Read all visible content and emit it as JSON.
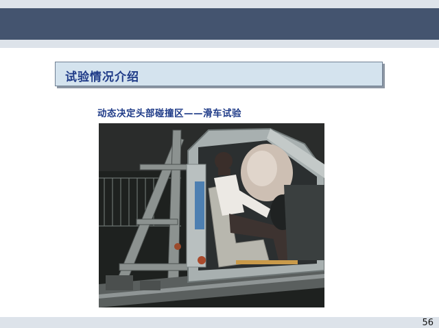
{
  "slide": {
    "section_title": "试验情况介绍",
    "subtitle": "动态决定头部碰撞区——滑车试验",
    "page_number": "56"
  }
}
